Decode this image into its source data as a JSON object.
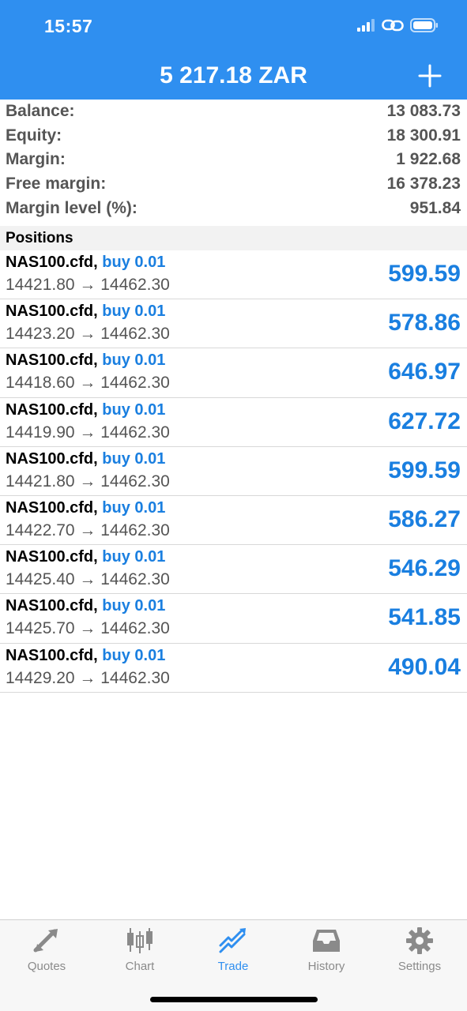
{
  "status_bar": {
    "time": "15:57"
  },
  "header": {
    "title": "5 217.18 ZAR"
  },
  "summary": [
    {
      "label": "Balance:",
      "value": "13 083.73"
    },
    {
      "label": "Equity:",
      "value": "18 300.91"
    },
    {
      "label": "Margin:",
      "value": "1 922.68"
    },
    {
      "label": "Free margin:",
      "value": "16 378.23"
    },
    {
      "label": "Margin level (%):",
      "value": "951.84"
    }
  ],
  "positions": {
    "title": "Positions",
    "items": [
      {
        "symbol": "NAS100.cfd,",
        "side": "buy 0.01",
        "prices": "14421.80 → 14462.30",
        "profit": "599.59"
      },
      {
        "symbol": "NAS100.cfd,",
        "side": "buy 0.01",
        "prices": "14423.20 → 14462.30",
        "profit": "578.86"
      },
      {
        "symbol": "NAS100.cfd,",
        "side": "buy 0.01",
        "prices": "14418.60 → 14462.30",
        "profit": "646.97"
      },
      {
        "symbol": "NAS100.cfd,",
        "side": "buy 0.01",
        "prices": "14419.90 → 14462.30",
        "profit": "627.72"
      },
      {
        "symbol": "NAS100.cfd,",
        "side": "buy 0.01",
        "prices": "14421.80 → 14462.30",
        "profit": "599.59"
      },
      {
        "symbol": "NAS100.cfd,",
        "side": "buy 0.01",
        "prices": "14422.70 → 14462.30",
        "profit": "586.27"
      },
      {
        "symbol": "NAS100.cfd,",
        "side": "buy 0.01",
        "prices": "14425.40 → 14462.30",
        "profit": "546.29"
      },
      {
        "symbol": "NAS100.cfd,",
        "side": "buy 0.01",
        "prices": "14425.70 → 14462.30",
        "profit": "541.85"
      },
      {
        "symbol": "NAS100.cfd,",
        "side": "buy 0.01",
        "prices": "14429.20 → 14462.30",
        "profit": "490.04"
      }
    ]
  },
  "tabbar": {
    "active": "Trade",
    "tabs": [
      {
        "label": "Quotes",
        "icon": "quotes-arrows-icon"
      },
      {
        "label": "Chart",
        "icon": "candlestick-icon"
      },
      {
        "label": "Trade",
        "icon": "trade-trend-icon"
      },
      {
        "label": "History",
        "icon": "inbox-tray-icon"
      },
      {
        "label": "Settings",
        "icon": "gear-icon"
      }
    ]
  },
  "colors": {
    "header_blue": "#2f8ff0",
    "profit_blue": "#1a7fe0",
    "muted_text": "#555555",
    "tab_inactive": "#8a8a8a"
  }
}
